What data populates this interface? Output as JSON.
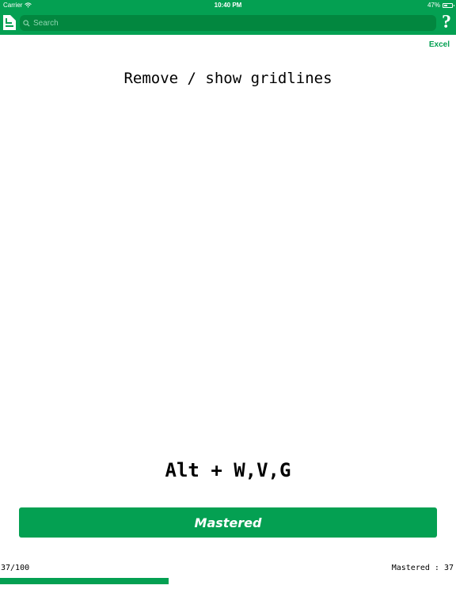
{
  "status_bar": {
    "carrier": "Carrier",
    "time": "10:40 PM",
    "battery": "47%",
    "battery_level": 0.47
  },
  "nav": {
    "search_placeholder": "Search",
    "help": "?",
    "doc_icon": "document-icon",
    "search_icon": "search-icon"
  },
  "excel_label": "Excel",
  "card": {
    "question": "Remove / show gridlines",
    "answer": "Alt + W,V,G"
  },
  "mastered_button_label": "Mastered",
  "progress": {
    "count_text": "37/100",
    "mastered_text": "Mastered : 37",
    "fraction": 0.37
  },
  "colors": {
    "accent": "#04a052",
    "search_bg": "#02873f"
  }
}
